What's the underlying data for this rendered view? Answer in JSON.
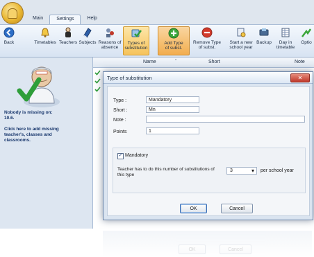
{
  "tabs": [
    "Main",
    "Settings",
    "Help"
  ],
  "ribbon": {
    "back": "Back",
    "timetables": "Timetables",
    "teachers": "Teachers",
    "subjects": "Subjects",
    "reasons_absence_l1": "Reasons of",
    "reasons_absence_l2": "absence",
    "types_subst_l1": "Types of",
    "types_subst_l2": "substitution",
    "add_type_l1": "Add Type",
    "add_type_l2": "of subst.",
    "remove_type_l1": "Remove Type",
    "remove_type_l2": "of subst.",
    "new_year_l1": "Start a new",
    "new_year_l2": "school year",
    "backup": "Backup",
    "day_tt_l1": "Day in",
    "day_tt_l2": "timetable",
    "options": "Optio"
  },
  "sidebar": {
    "missing_line1": "Nobody is missing on:",
    "missing_line2": "10.6.",
    "add_line1": "Click here to add missing",
    "add_line2": "teacher's, classes and",
    "add_line3": "classrooms."
  },
  "grid": {
    "col_name": "Name",
    "col_sort": "ˇ",
    "col_short": "Short",
    "col_note": "Note"
  },
  "dialog": {
    "title": "Type of substitution",
    "close_glyph": "✕",
    "type_label": "Type :",
    "type_value": "Mandatory",
    "short_label": "Short :",
    "short_value": "Mn",
    "note_label": "Note :",
    "note_value": "",
    "points_label": "Points",
    "points_value": "1",
    "mandatory_label": "Mandatory",
    "mandatory_checked": true,
    "check_glyph": "✓",
    "teacher_text_l1": "Teacher has to do this number of substitutions of",
    "teacher_text_l2": "this type",
    "count_value": "3",
    "per_year": "per school year",
    "dropdown_glyph": "▾",
    "ok": "OK",
    "cancel": "Cancel"
  },
  "colors": {
    "ribbon_selected": "#f6c35c",
    "dialog_bg": "#dae4f0",
    "close_red": "#c0392b",
    "check_green": "#3aa63a"
  }
}
